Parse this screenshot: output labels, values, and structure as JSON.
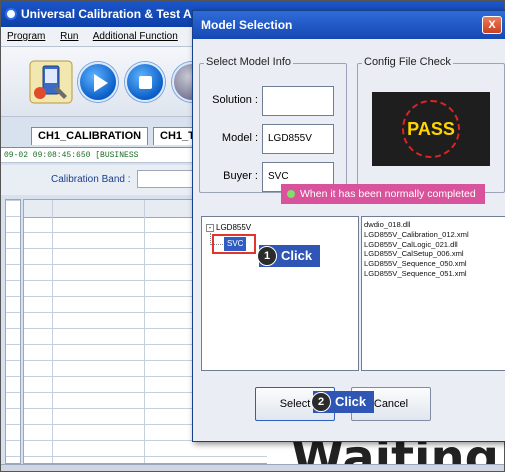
{
  "app": {
    "title": "Universal Calibration & Test A",
    "menu": [
      "Program",
      "Run",
      "Additional Function"
    ],
    "tabs": [
      "CH1_CALIBRATION",
      "CH1_T"
    ],
    "status_line": "09-02  09:08:45:650  [BUSINESS",
    "calibration_band_label": "Calibration Band :",
    "big_status_text": "Waiting"
  },
  "dialog": {
    "title": "Model Selection",
    "close_glyph": "X",
    "select_model_info": {
      "group_label": "Select Model Info",
      "fields": [
        {
          "label": "Solution :",
          "value": ""
        },
        {
          "label": "Model :",
          "value": "LGD855V"
        },
        {
          "label": "Buyer :",
          "value": "SVC"
        }
      ]
    },
    "config_file_check": {
      "group_label": "Config File Check",
      "result": "PASS"
    },
    "notice": "When it has been normally completed",
    "tree": {
      "root": "LGD855V",
      "expander": "-",
      "child": "SVC"
    },
    "files": [
      "dwdio_018.dll",
      "LGD855V_Calibration_012.xml",
      "LGD855V_CalLogic_021.dll",
      "LGD855V_CalSetup_006.xml",
      "LGD855V_Sequence_050.xml",
      "LGD855V_Sequence_051.xml"
    ],
    "buttons": {
      "select": "Select",
      "cancel": "Cancel"
    },
    "annotations": [
      {
        "number": "1",
        "text": "Click"
      },
      {
        "number": "2",
        "text": "Click"
      }
    ]
  }
}
